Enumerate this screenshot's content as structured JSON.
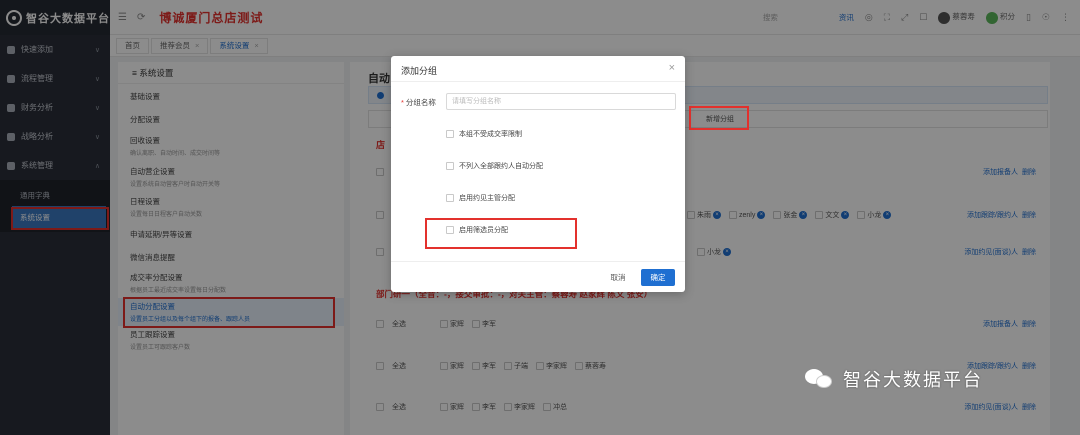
{
  "app": {
    "name": "智谷大数据平台",
    "company": "博诚厦门总店测试"
  },
  "header": {
    "search_placeholder": "搜索",
    "link": "资讯",
    "user": "蔡蓉寿",
    "points": "积分"
  },
  "sidebar": {
    "items": [
      {
        "label": "快速添加"
      },
      {
        "label": "流程管理"
      },
      {
        "label": "财务分析"
      },
      {
        "label": "战略分析"
      },
      {
        "label": "系统管理"
      }
    ],
    "sub": [
      {
        "label": "通用字典"
      },
      {
        "label": "系统设置"
      }
    ]
  },
  "tabs": [
    {
      "label": "首页"
    },
    {
      "label": "推荐会员"
    },
    {
      "label": "系统设置"
    }
  ],
  "settings": {
    "title": "系统设置",
    "items": [
      {
        "label": "基础设置",
        "desc": ""
      },
      {
        "label": "分配设置",
        "desc": ""
      },
      {
        "label": "回收设置",
        "desc": "确认离职、自动时间、成交时间等"
      },
      {
        "label": "自动营企设置",
        "desc": "设置系统自动营客户时自动开关等"
      },
      {
        "label": "日程设置",
        "desc": "设置每日日程客户自动关数"
      },
      {
        "label": "申请延期/异等设置",
        "desc": ""
      },
      {
        "label": "微信消息提醒",
        "desc": ""
      },
      {
        "label": "成交率分配设置",
        "desc": "根据员工最近成交率设置每日分配数"
      },
      {
        "label": "自动分配设置",
        "desc": "设置员工分组以及每个组下的报备、跟踪人员"
      },
      {
        "label": "员工跟踪设置",
        "desc": "设置员工可跟踪客户数"
      }
    ]
  },
  "main": {
    "title": "自动",
    "add_group": "新增分组",
    "group1": "店",
    "group2": "部门研一（全音：-，接交审批：-，对关主管：蔡蓉寿 赵家辉 陈文 张安）",
    "rows1": [
      {
        "check_label": "",
        "names": [],
        "action": "添加报备人",
        "del": "删除"
      },
      {
        "check_label": "",
        "names": [
          "朱雨",
          "zenly",
          "张金",
          "文文",
          "小龙"
        ],
        "action": "添加跟踪/跟约人",
        "del": "删除"
      },
      {
        "check_label": "",
        "names": [
          "小龙"
        ],
        "action": "添加约见(面谈)人",
        "del": "删除"
      }
    ],
    "rows2": [
      {
        "check_label": "全选",
        "names": [
          "家辉",
          "李军"
        ],
        "action": "添加报备人",
        "del": "删除"
      },
      {
        "check_label": "全选",
        "names": [
          "家辉",
          "李军",
          "子端",
          "李家辉",
          "蔡蓉寿"
        ],
        "action": "添加跟踪/跟约人",
        "del": "删除"
      },
      {
        "check_label": "全选",
        "names": [
          "家辉",
          "李军",
          "李家辉",
          "冲总"
        ],
        "action": "添加约见(面谈)人",
        "del": "删除"
      }
    ]
  },
  "dialog": {
    "title": "添加分组",
    "name_label": "分组名称",
    "name_placeholder": "请填写分组名称",
    "options": [
      {
        "label": "本组不受成交率限制"
      },
      {
        "label": "不列入全部跟约人自动分配"
      },
      {
        "label": "启用约见主管分配"
      },
      {
        "label": "启用筛选员分配"
      }
    ],
    "cancel": "取消",
    "ok": "确定"
  },
  "watermark": {
    "text": "智谷大数据平台"
  }
}
